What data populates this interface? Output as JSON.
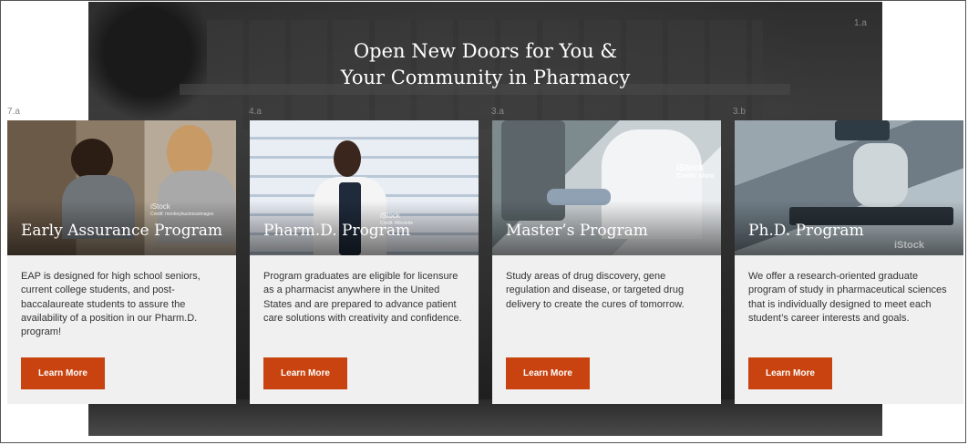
{
  "hero": {
    "title_line1": "Open New Doors for You &",
    "title_line2": "Your Community in Pharmacy"
  },
  "markers": {
    "hero": "1.a",
    "card1": "7.a",
    "card2": "4.a",
    "card3": "3.a",
    "card4": "3.b"
  },
  "cards": [
    {
      "title": "Early Assurance Program",
      "description": "EAP is designed for high school seniors, current college students, and post-baccalaureate students to assure the availability of a position in our Pharm.D. program!",
      "button": "Learn More",
      "watermark": "iStock",
      "credit": "Credit: monkeybusinessimages"
    },
    {
      "title": "Pharm.D. Program",
      "description": "Program graduates are eligible for licensure as a pharmacist anywhere in the United States and are prepared to advance patient care solutions with creativity and confidence.",
      "button": "Learn More",
      "watermark": "iStock",
      "credit": "Credit: Mikolette"
    },
    {
      "title": "Master’s Program",
      "description": "Study areas of drug discovery, gene regulation and disease, or targeted drug delivery to create the cures of tomorrow.",
      "button": "Learn More",
      "watermark": "iStock",
      "credit": "Credit: shiro"
    },
    {
      "title": "Ph.D. Program",
      "description": "We offer a research-oriented graduate program of study in pharmaceutical sciences that is individually designed to meet each student’s career interests and goals.",
      "button": "Learn More",
      "watermark": "iStock",
      "credit": ""
    }
  ],
  "colors": {
    "button": "#c8430f",
    "card_bg": "#f0f0f0",
    "hero_bg": "#333333"
  }
}
